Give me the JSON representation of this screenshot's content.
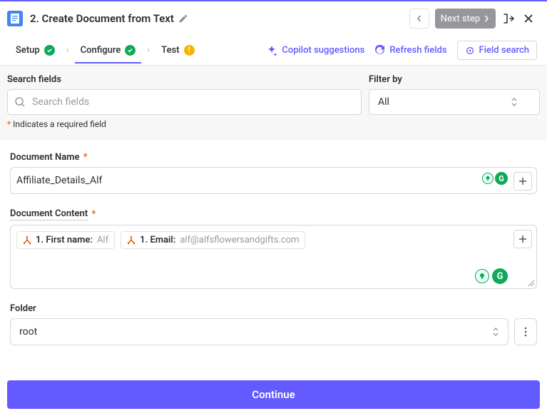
{
  "header": {
    "title": "2. Create Document from Text",
    "next_label": "Next step"
  },
  "tabs": {
    "setup": "Setup",
    "configure": "Configure",
    "test": "Test"
  },
  "actions": {
    "copilot": "Copilot suggestions",
    "refresh": "Refresh fields",
    "field_search": "Field search"
  },
  "filters": {
    "search_label": "Search fields",
    "search_placeholder": "Search fields",
    "filterby_label": "Filter by",
    "filterby_value": "All",
    "required_note": "Indicates a required field"
  },
  "form": {
    "doc_name_label": "Document Name",
    "doc_name_value": "Affiliate_Details_Alf",
    "doc_content_label": "Document Content",
    "pills": [
      {
        "label": "1. First name:",
        "value": "Alf"
      },
      {
        "label": "1. Email:",
        "value": "alf@alfsflowersandgifts.com"
      }
    ],
    "folder_label": "Folder",
    "folder_value": "root"
  },
  "footer": {
    "continue": "Continue"
  }
}
